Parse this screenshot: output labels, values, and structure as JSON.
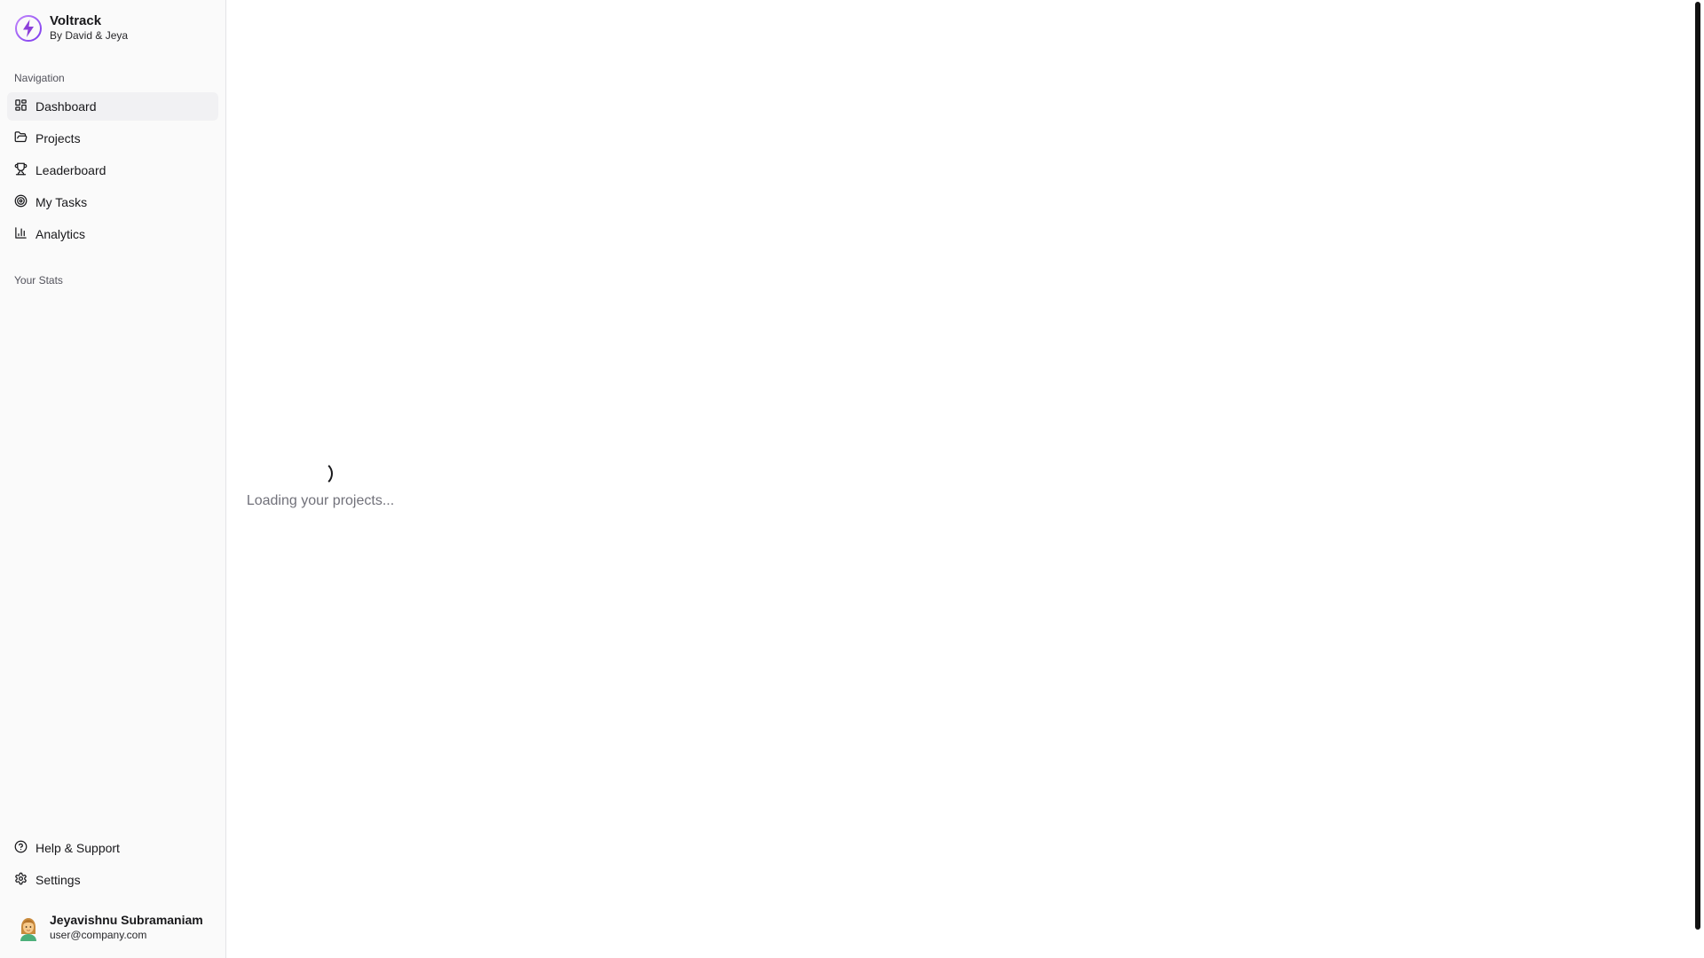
{
  "brand": {
    "name": "Voltrack",
    "subtitle": "By David & Jeya",
    "accent_color": "#a855f7"
  },
  "sidebar": {
    "navigation_label": "Navigation",
    "items": [
      {
        "label": "Dashboard",
        "icon": "dashboard-grid-icon",
        "active": true
      },
      {
        "label": "Projects",
        "icon": "folder-icon",
        "active": false
      },
      {
        "label": "Leaderboard",
        "icon": "trophy-icon",
        "active": false
      },
      {
        "label": "My Tasks",
        "icon": "target-icon",
        "active": false
      },
      {
        "label": "Analytics",
        "icon": "bar-chart-icon",
        "active": false
      }
    ],
    "stats_label": "Your Stats",
    "footer_items": [
      {
        "label": "Help & Support",
        "icon": "help-circle-icon"
      },
      {
        "label": "Settings",
        "icon": "gear-icon"
      }
    ]
  },
  "user": {
    "name": "Jeyavishnu Subramaniam",
    "email": "user@company.com",
    "avatar_icon": "person-emoji-icon"
  },
  "main": {
    "loading_text": "Loading your projects..."
  }
}
